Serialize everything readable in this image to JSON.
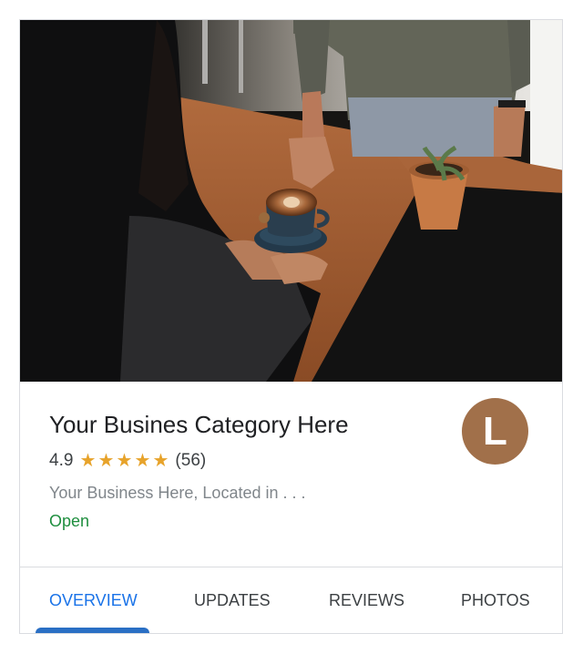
{
  "card": {
    "title": "Your Busines Category Here",
    "rating": {
      "value": "4.9",
      "stars": 5,
      "star_glyph": "★",
      "count": "(56)"
    },
    "address": "Your Business Here, Located in . . .",
    "status": "Open",
    "avatar_letter": "L",
    "colors": {
      "avatar": "#a1704a",
      "star": "#e7a32b",
      "status": "#1e8e3e",
      "active_tab": "#1a73e8"
    }
  },
  "tabs": [
    {
      "label": "OVERVIEW",
      "active": true
    },
    {
      "label": "UPDATES",
      "active": false
    },
    {
      "label": "REVIEWS",
      "active": false
    },
    {
      "label": "PHOTOS",
      "active": false
    }
  ]
}
